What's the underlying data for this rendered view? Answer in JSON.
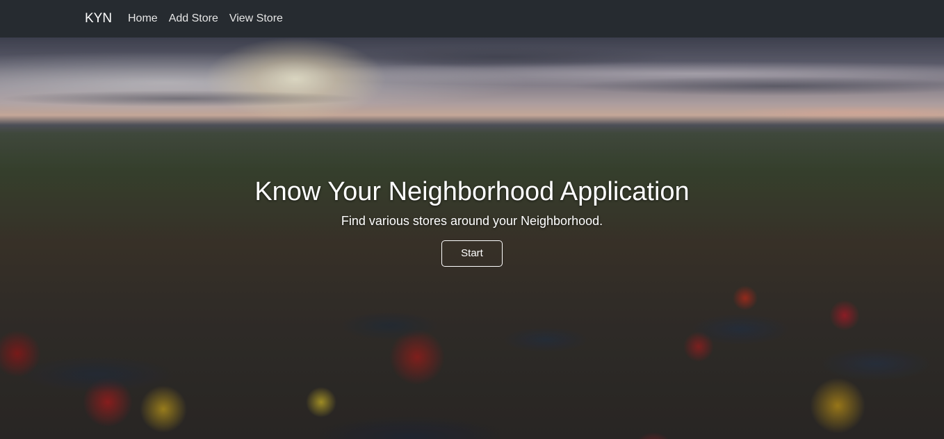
{
  "navbar": {
    "brand": "KYN",
    "links": [
      {
        "label": "Home"
      },
      {
        "label": "Add Store"
      },
      {
        "label": "View Store"
      }
    ]
  },
  "hero": {
    "title": "Know Your Neighborhood Application",
    "subtitle": "Find various stores around your Neighborhood.",
    "button_label": "Start"
  },
  "colors": {
    "navbar_bg": "#262b30",
    "text": "#ffffff"
  }
}
